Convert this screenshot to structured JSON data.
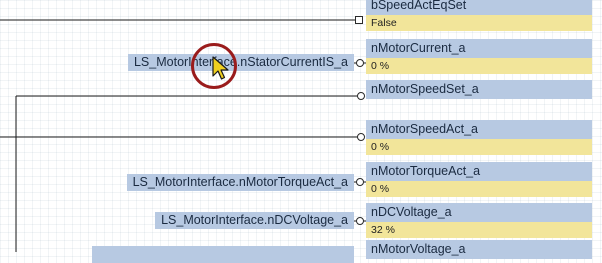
{
  "ports": [
    {
      "name": "bSpeedActEqSet",
      "value": "False"
    },
    {
      "name": "nMotorCurrent_a",
      "value": "0 %"
    },
    {
      "name": "nMotorSpeedSet_a",
      "value": ""
    },
    {
      "name": "nMotorSpeedAct_a",
      "value": "0 %"
    },
    {
      "name": "nMotorTorqueAct_a",
      "value": "0 %"
    },
    {
      "name": "nDCVoltage_a",
      "value": "32 %"
    },
    {
      "name": "nMotorVoltage_a",
      "value": ""
    }
  ],
  "inputs": {
    "stator_current": "LS_MotorInterface.nStatorCurrentIS_a",
    "torque_act": "LS_MotorInterface.nMotorTorqueAct_a",
    "dc_voltage": "LS_MotorInterface.nDCVoltage_a"
  },
  "colors": {
    "port_name_bg": "#b7c9e2",
    "port_value_bg": "#f2e59a",
    "highlight_ring": "#9a1c1c",
    "cursor": "#f0d020"
  }
}
